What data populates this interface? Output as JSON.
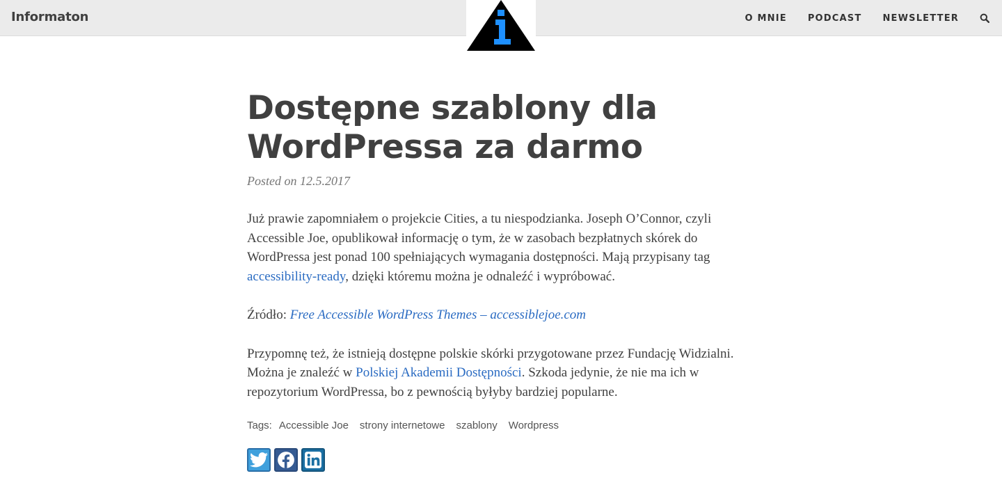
{
  "site": {
    "title": "Informaton"
  },
  "nav": {
    "items": [
      {
        "label": "O MNIE"
      },
      {
        "label": "PODCAST"
      },
      {
        "label": "NEWSLETTER"
      }
    ],
    "search_icon": "search-icon"
  },
  "logo": {
    "icon": "info-triangle-logo",
    "colors": {
      "triangle": "#000000",
      "letter": "#1e90ff"
    }
  },
  "post": {
    "title_line1": "Dostępne szablony dla",
    "title_line2": "WordPressa za darmo",
    "meta_prefix": "Posted on",
    "date": "12.5.2017",
    "p1_a": "Już prawie zapomniałem o projekcie Cities, a tu niespodzianka. Joseph O’Connor, czyli Accessible Joe, opublikował informację o tym, że w zasobach bezpłatnych skórek do WordPressa jest ponad 100 spełniających wymagania dostępności. Mają przypisany tag ",
    "p1_link": "accessibility-ready",
    "p1_b": ", dzięki któremu można je odnaleźć i wypróbować.",
    "source_label": "Źródło: ",
    "source_link": "Free Accessible WordPress Themes – accessiblejoe.com",
    "p3_a": "Przypomnę też, że istnieją dostępne polskie skórki przygotowane przez Fundację Widzialni. Można je znaleźć w ",
    "p3_link": "Polskiej Akademii Dostępności",
    "p3_b": ". Szkoda jedynie, że nie ma ich w repozytorium WordPressa, bo z pewnością byłyby bardziej popularne."
  },
  "tags": {
    "label": "Tags:",
    "items": [
      "Accessible Joe",
      "strony internetowe",
      "szablony",
      "Wordpress"
    ]
  },
  "share": {
    "buttons": [
      {
        "icon": "twitter-icon",
        "color": "#3fa0dc"
      },
      {
        "icon": "facebook-icon",
        "color": "#355b93"
      },
      {
        "icon": "linkedin-icon",
        "color": "#1a6fa3"
      }
    ]
  },
  "colors": {
    "link": "#2a6bc2",
    "text": "#404040",
    "topbar": "#ebebeb"
  }
}
